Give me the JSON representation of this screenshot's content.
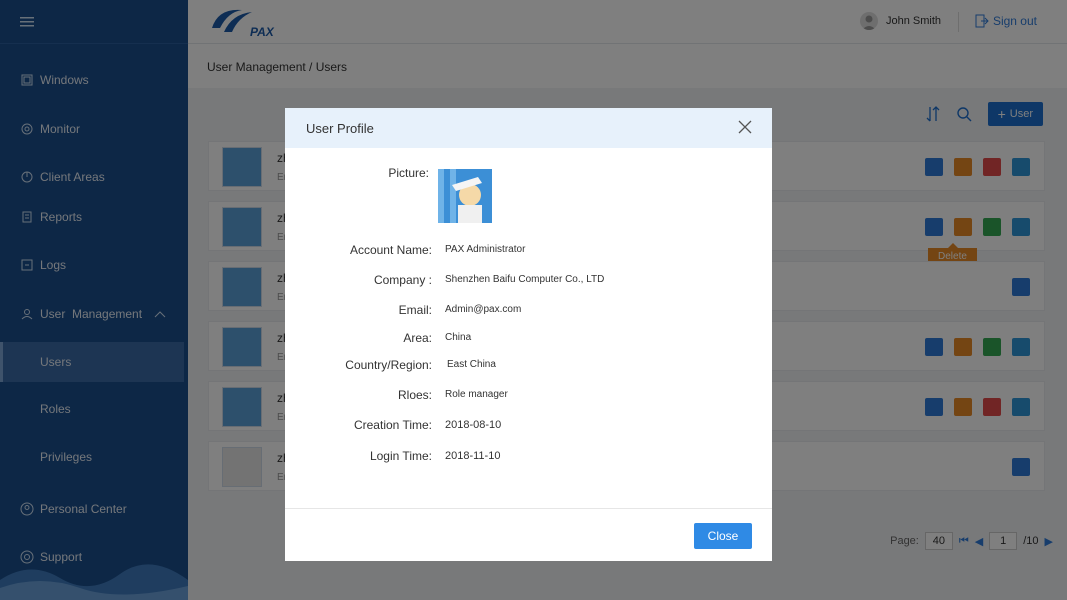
{
  "sidebar": {
    "items": [
      {
        "label": "Windows"
      },
      {
        "label": "Monitor"
      },
      {
        "label": "Client Areas"
      },
      {
        "label": "Reports"
      },
      {
        "label": "Logs"
      },
      {
        "label": "User  Management"
      },
      {
        "label": "Users"
      },
      {
        "label": "Roles"
      },
      {
        "label": "Privileges"
      },
      {
        "label": "Personal Center"
      },
      {
        "label": "Support"
      }
    ]
  },
  "header": {
    "logo_text": "PAX",
    "user_name": "John Smith",
    "signout_label": "Sign out"
  },
  "breadcrumb": "User Management / Users",
  "toolbar": {
    "add_user_label": "User"
  },
  "rows": [
    {
      "name": "zh",
      "sub": "En"
    },
    {
      "name": "zh",
      "sub": "En"
    },
    {
      "name": "zh",
      "sub": "En"
    },
    {
      "name": "zh",
      "sub": "En"
    },
    {
      "name": "zh",
      "sub": "En"
    },
    {
      "name": "zh",
      "sub": "En"
    }
  ],
  "tooltip": "Delete",
  "pager": {
    "page_label": "Page:",
    "page_size": "40",
    "current_page": "1",
    "total_pages": "/10"
  },
  "modal": {
    "title": "User Profile",
    "picture_label": "Picture:",
    "fields": [
      {
        "label": "Account Name:",
        "value": "PAX Administrator"
      },
      {
        "label": "Company :",
        "value": "Shenzhen Baifu Computer Co., LTD"
      },
      {
        "label": "Email:",
        "value": "Admin@pax.com"
      },
      {
        "label": "Area:",
        "value": "China"
      },
      {
        "label": "Country/Region:",
        "value": "East China"
      },
      {
        "label": "Rloes:",
        "value": "Role manager"
      },
      {
        "label": "Creation Time:",
        "value": "2018-08-10"
      },
      {
        "label": "Login Time:",
        "value": "2018-11-10"
      }
    ],
    "close_label": "Close"
  },
  "colors": {
    "sidebar_bg": "#1a4e8c",
    "primary": "#1c6fcf",
    "delete": "#e98b26",
    "ban": "#e24b4b",
    "approve": "#34a853"
  }
}
